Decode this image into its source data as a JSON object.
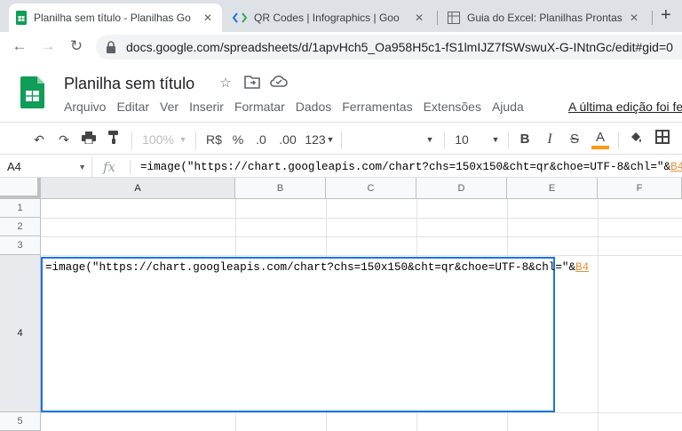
{
  "browser": {
    "tabs": [
      {
        "title": "Planilha sem título - Planilhas Go",
        "icon": "sheets-icon",
        "active": true
      },
      {
        "title": "QR Codes | Infographics | Goo",
        "icon": "code-icon",
        "active": false
      },
      {
        "title": "Guia do Excel: Planilhas Prontas",
        "icon": "excel-icon",
        "active": false
      }
    ],
    "close_glyph": "✕",
    "new_tab_glyph": "+",
    "url": "docs.google.com/spreadsheets/d/1apvHch5_Oa958H5c1-fS1lmIJZ7fSWswuX-G-INtnGc/edit#gid=0"
  },
  "doc": {
    "title": "Planilha sem título",
    "menu": [
      "Arquivo",
      "Editar",
      "Ver",
      "Inserir",
      "Formatar",
      "Dados",
      "Ferramentas",
      "Extensões",
      "Ajuda"
    ],
    "last_edit": "A última edição foi fe"
  },
  "toolbar": {
    "zoom": "100%",
    "currency": "R$",
    "percent": "%",
    "dec_less": ".0",
    "dec_more": ".00",
    "more_formats": "123",
    "font_size": "10",
    "bold": "B",
    "italic": "I",
    "strike": "S",
    "text_color": "A",
    "text_color_bar": "#ff9900"
  },
  "formula_bar": {
    "cell_ref": "A4",
    "fx": "fx",
    "formula_prefix": "=image(\"https://chart.googleapis.com/chart?chs=150x150&cht=qr&choe=UTF-8&chl=\"&",
    "formula_ref": "B4"
  },
  "grid": {
    "columns": [
      "A",
      "B",
      "C",
      "D",
      "E",
      "F"
    ],
    "rows": [
      "1",
      "2",
      "3",
      "4",
      "5"
    ],
    "selected_column": "A",
    "selected_row": "4",
    "active_cell": {
      "text_prefix": "=image(\"https://chart.googleapis.com/chart?chs=150x150&cht=qr&choe=UTF-8&chl=\"&",
      "text_ref": "B4"
    }
  },
  "colors": {
    "accent": "#1a73e8",
    "sheets_green": "#0f9d58",
    "ref_orange": "#e69138"
  }
}
